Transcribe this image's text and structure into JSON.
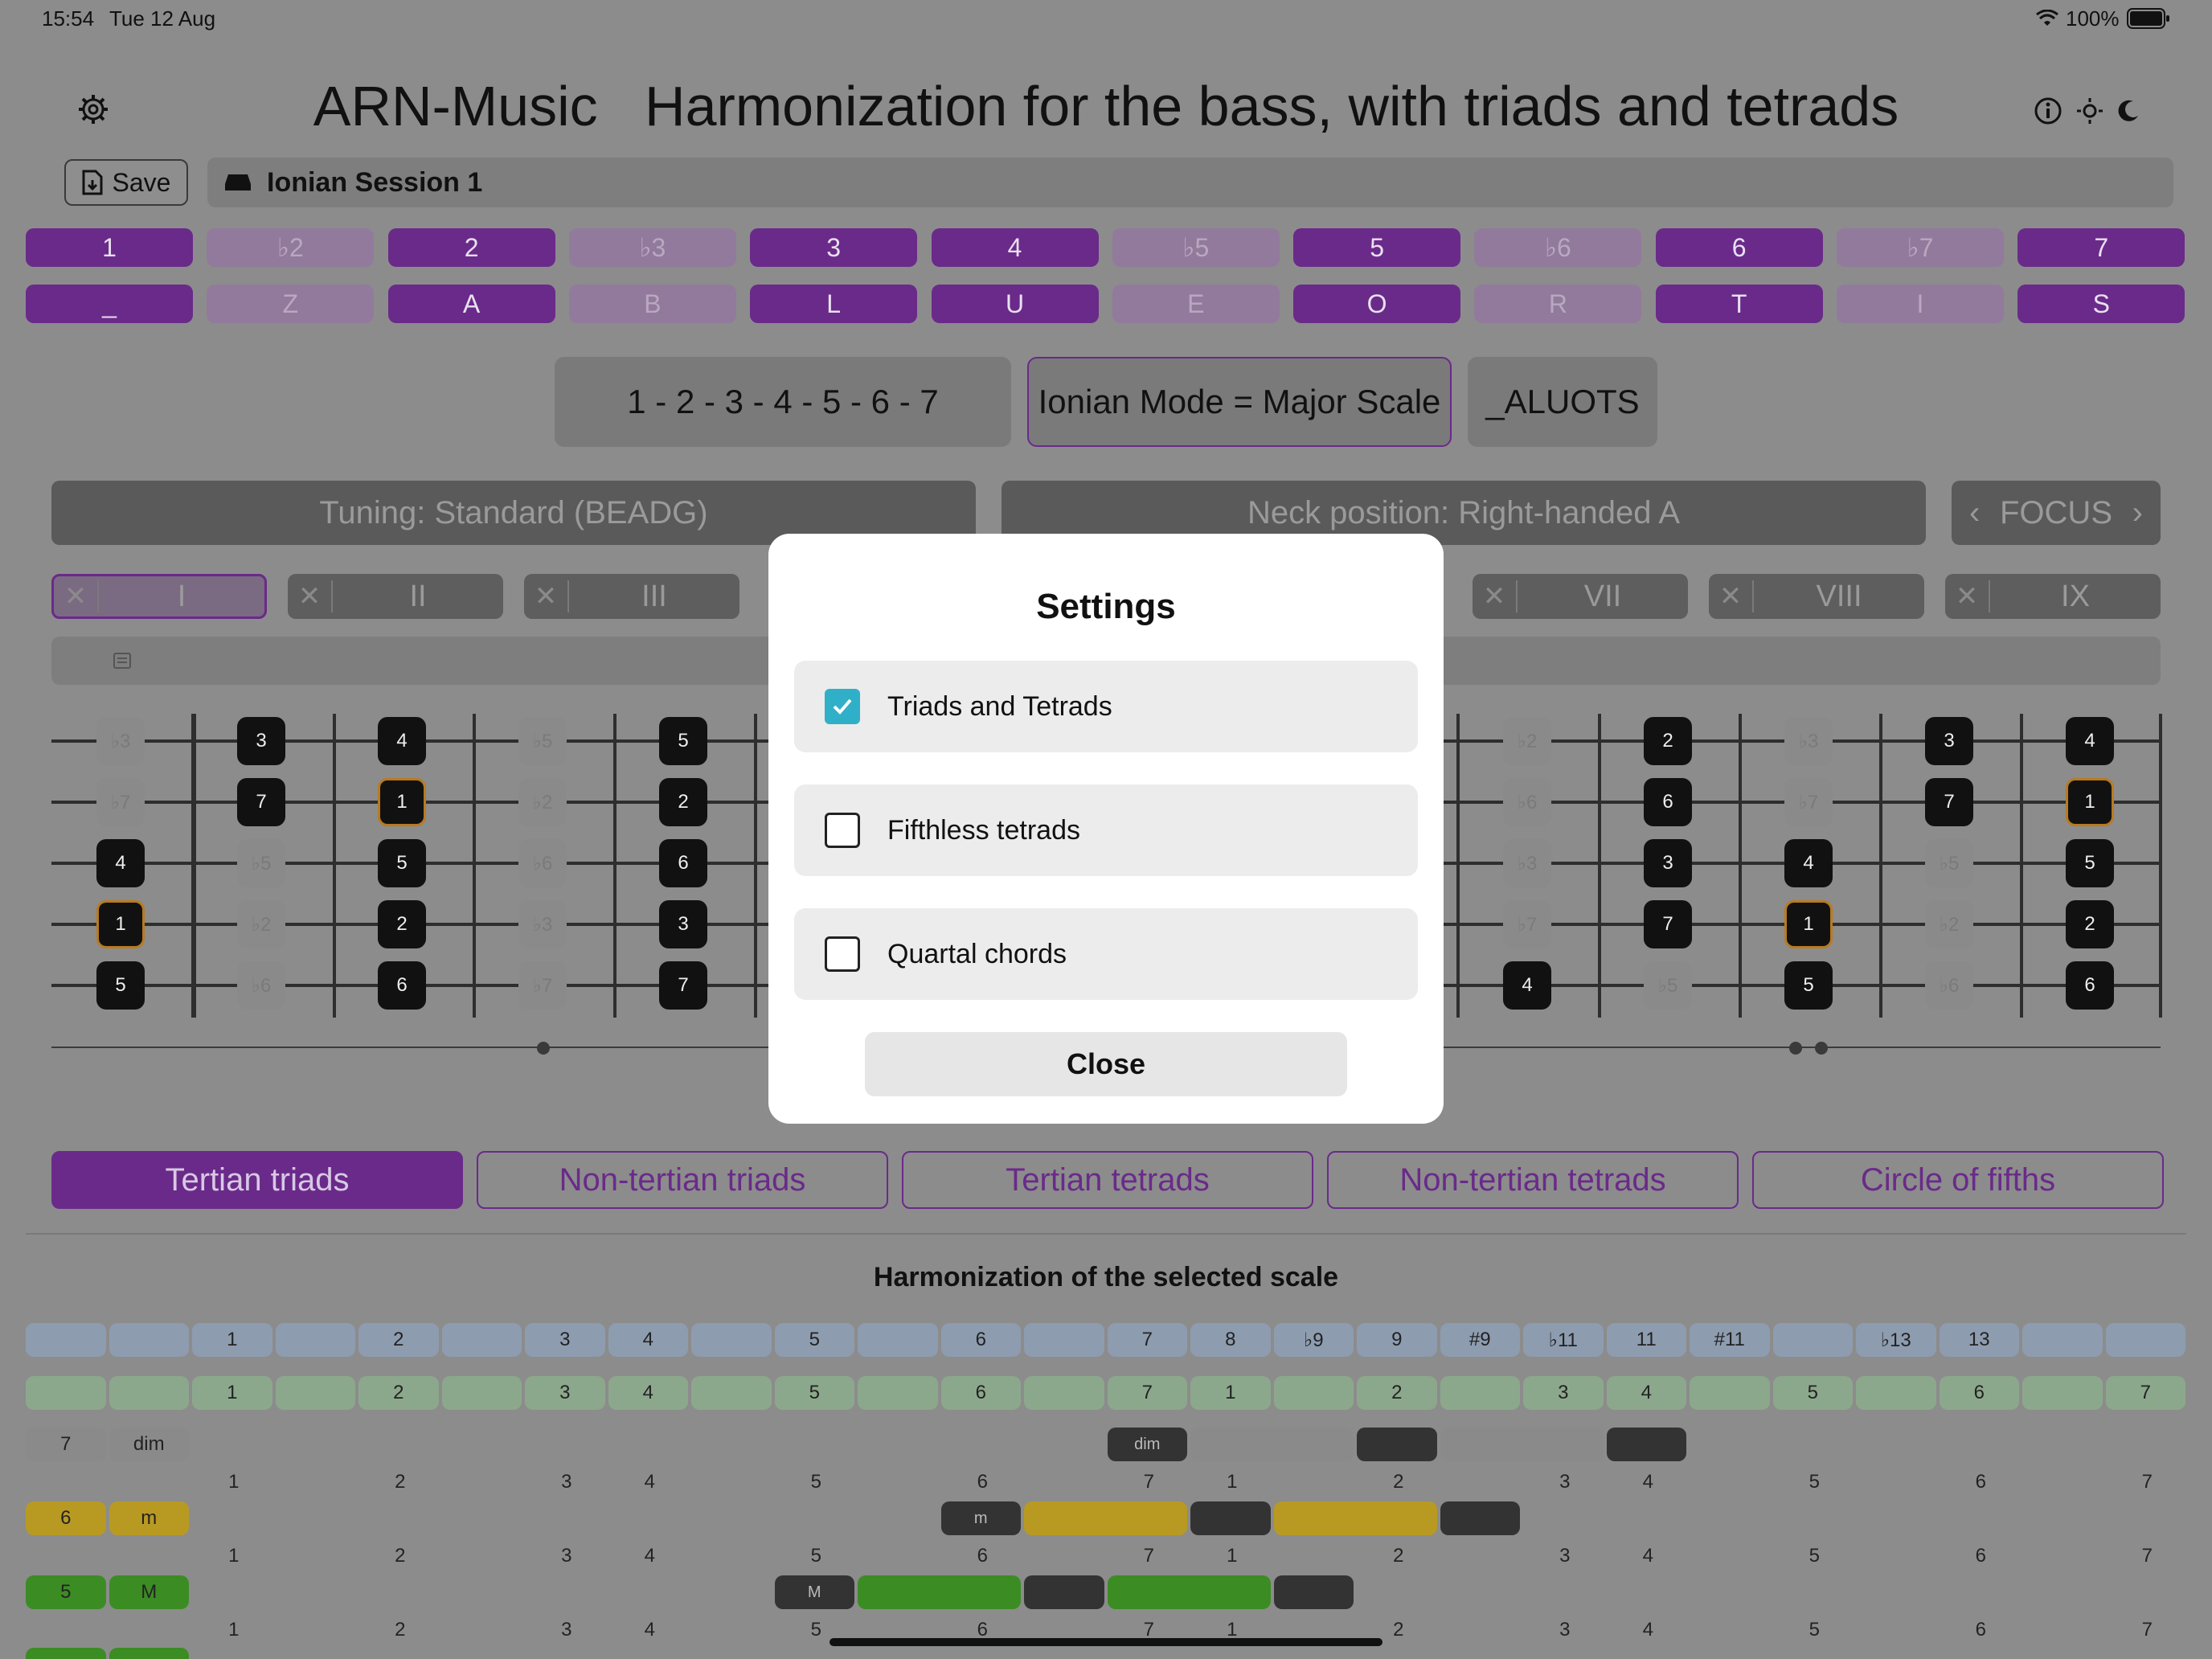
{
  "status_bar": {
    "time": "15:54",
    "date": "Tue 12 Aug",
    "battery": "100%"
  },
  "header": {
    "app_name": "ARN-Music",
    "subtitle": "Harmonization for the bass, with triads and tetrads"
  },
  "toolbar": {
    "save_label": "Save",
    "session_name": "Ionian Session 1"
  },
  "degrees": {
    "numbers": [
      "1",
      "♭2",
      "2",
      "♭3",
      "3",
      "4",
      "♭5",
      "5",
      "♭6",
      "6",
      "♭7",
      "7"
    ],
    "letters": [
      "_",
      "Z",
      "A",
      "B",
      "L",
      "U",
      "E",
      "O",
      "R",
      "T",
      "I",
      "S"
    ],
    "active": [
      true,
      false,
      true,
      false,
      true,
      true,
      false,
      true,
      false,
      true,
      false,
      true
    ]
  },
  "scale_info": {
    "formula": "1 - 2 - 3 - 4 - 5 - 6 - 7",
    "mode": "Ionian Mode = Major Scale",
    "code": "_ALUOTS"
  },
  "controls": {
    "tuning": "Tuning: Standard (BEADG)",
    "neck": "Neck position: Right-handed A",
    "focus": "FOCUS"
  },
  "positions": [
    "I",
    "II",
    "III",
    "VII",
    "VIII",
    "IX"
  ],
  "fretboard_left": [
    [
      "♭3",
      "3",
      "4",
      "♭5",
      "5"
    ],
    [
      "♭7",
      "7",
      "1",
      "♭2",
      "2"
    ],
    [
      "4",
      "♭5",
      "5",
      "♭6",
      "6"
    ],
    [
      "1",
      "♭2",
      "2",
      "♭3",
      "3"
    ],
    [
      "5",
      "♭6",
      "6",
      "♭7",
      "7"
    ]
  ],
  "fretboard_right": [
    [
      "♭2",
      "2",
      "♭3",
      "3",
      "4"
    ],
    [
      "♭6",
      "6",
      "♭7",
      "7",
      "1"
    ],
    [
      "♭3",
      "3",
      "4",
      "♭5",
      "5"
    ],
    [
      "♭7",
      "7",
      "1",
      "♭2",
      "2"
    ],
    [
      "4",
      "♭5",
      "5",
      "♭6",
      "6"
    ]
  ],
  "chord_tabs": [
    "Tertian triads",
    "Non-tertian triads",
    "Tertian tetrads",
    "Non-tertian tetrads",
    "Circle of fifths"
  ],
  "harmonization": {
    "title": "Harmonization of the selected scale",
    "row_intervals": [
      "",
      "",
      "1",
      "",
      "2",
      "",
      "3",
      "4",
      "",
      "5",
      "",
      "6",
      "",
      "7",
      "8",
      "♭9",
      "9",
      "#9",
      "♭11",
      "11",
      "#11",
      "",
      "♭13",
      "13",
      "",
      ""
    ],
    "row_degrees": [
      "",
      "",
      "1",
      "",
      "2",
      "",
      "3",
      "4",
      "",
      "5",
      "",
      "6",
      "",
      "7",
      "1",
      "",
      "2",
      "",
      "3",
      "4",
      "",
      "5",
      "",
      "6",
      "",
      "7"
    ],
    "degree_labels": [
      "1",
      "2",
      "3",
      "4",
      "5",
      "6",
      "7",
      "1",
      "2",
      "3",
      "4",
      "5",
      "6",
      "7"
    ],
    "chords": [
      {
        "degree": "7",
        "quality": "dim",
        "badge": "dim"
      },
      {
        "degree": "6",
        "quality": "m",
        "badge": "m"
      },
      {
        "degree": "5",
        "quality": "M",
        "badge": "M"
      }
    ]
  },
  "settings_modal": {
    "title": "Settings",
    "options": [
      {
        "label": "Triads and Tetrads",
        "checked": true
      },
      {
        "label": "Fifthless tetrads",
        "checked": false
      },
      {
        "label": "Quartal chords",
        "checked": false
      }
    ],
    "close_label": "Close"
  },
  "colors": {
    "accent": "#8a2be2",
    "checkbox": "#30b0c8",
    "dim": "#8a8a8a",
    "minor": "#c8a020",
    "major": "#3c9c28"
  }
}
